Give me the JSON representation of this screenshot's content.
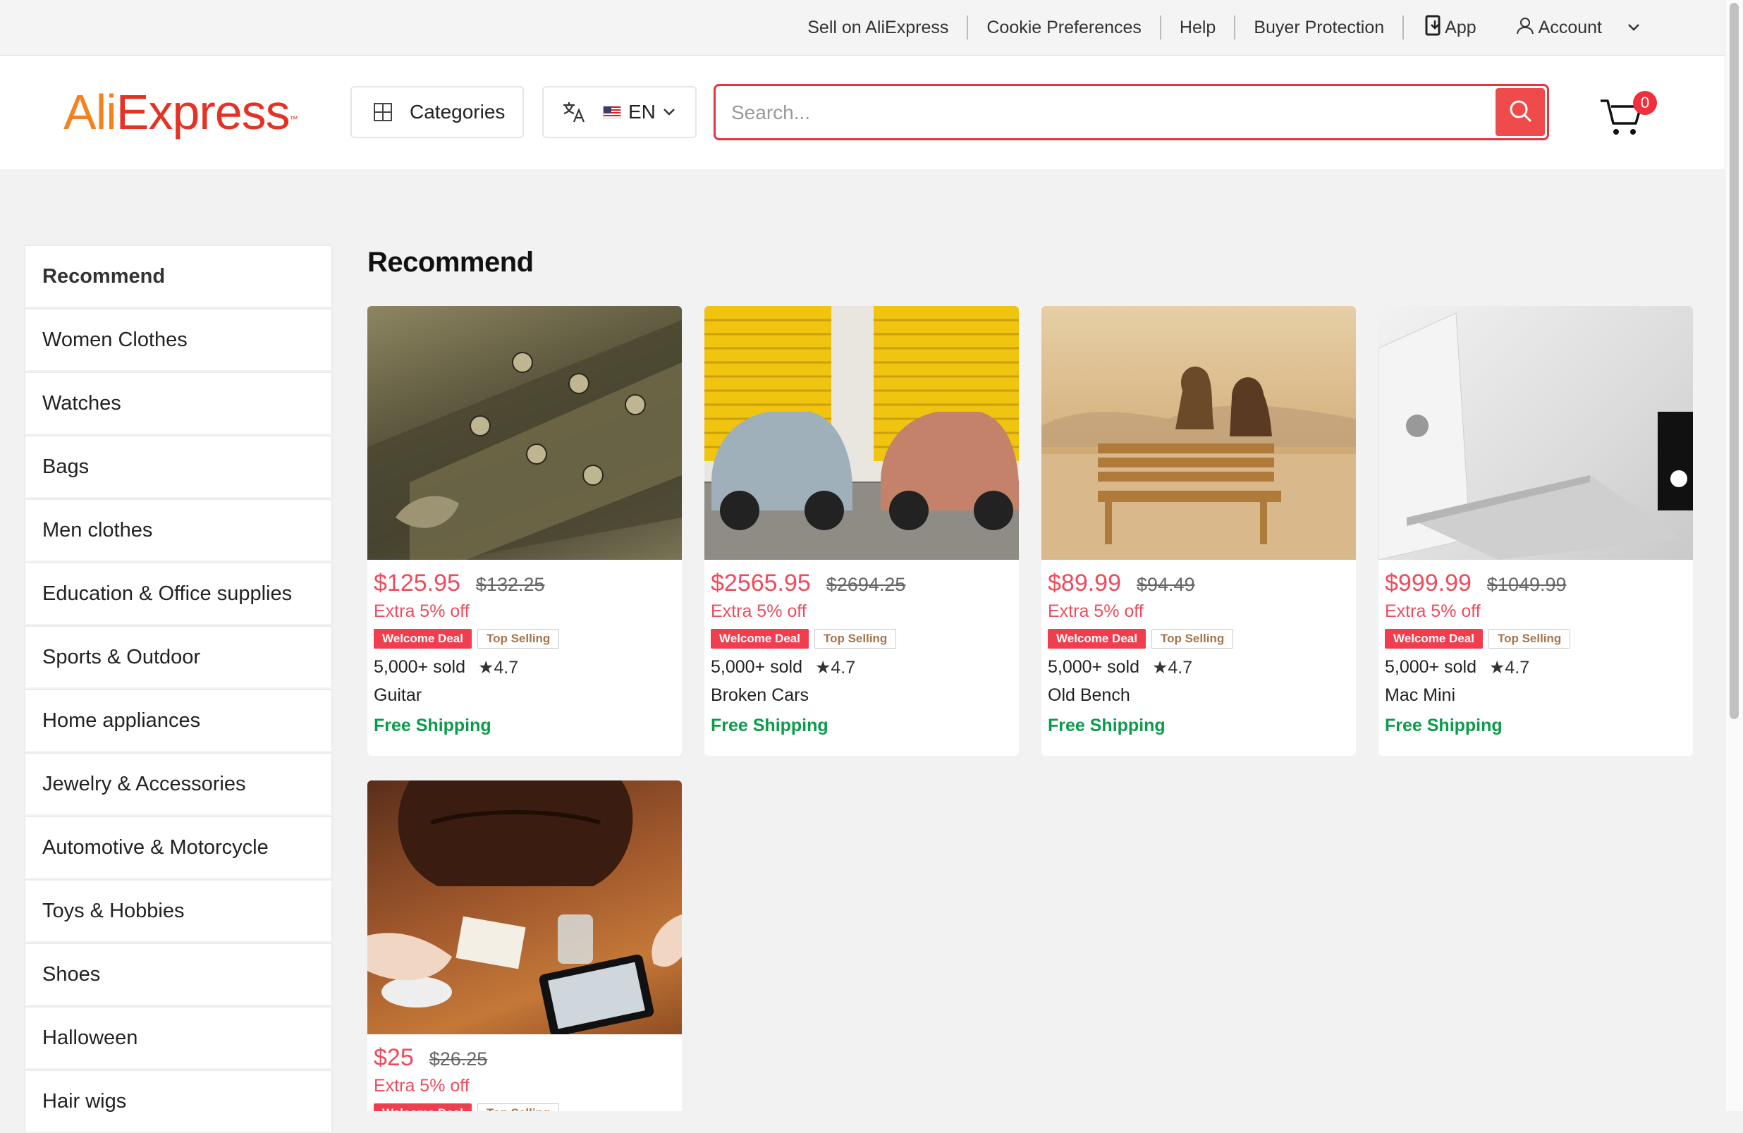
{
  "topbar": {
    "links": [
      "Sell on AliExpress",
      "Cookie Preferences",
      "Help",
      "Buyer Protection"
    ],
    "app_label": "App",
    "account_label": "Account"
  },
  "header": {
    "logo_part1": "Ali",
    "logo_part2": "Express",
    "categories_label": "Categories",
    "language_label": "EN",
    "search_placeholder": "Search...",
    "cart_count": "0"
  },
  "sidebar": {
    "items": [
      "Recommend",
      "Women Clothes",
      "Watches",
      "Bags",
      "Men clothes",
      "Education & Office supplies",
      "Sports & Outdoor",
      "Home appliances",
      "Jewelry & Accessories",
      "Automotive & Motorcycle",
      "Toys & Hobbies",
      "Shoes",
      "Halloween",
      "Hair wigs"
    ]
  },
  "main": {
    "title": "Recommend",
    "products": [
      {
        "price": "$125.95",
        "old_price": "$132.25",
        "extra": "Extra 5% off",
        "tag1": "Welcome Deal",
        "tag2": "Top Selling",
        "sold": "5,000+ sold",
        "rating": "★4.7",
        "name": "Guitar",
        "shipping": "Free Shipping",
        "image": "guitar-headstock-photo"
      },
      {
        "price": "$2565.95",
        "old_price": "$2694.25",
        "extra": "Extra 5% off",
        "tag1": "Welcome Deal",
        "tag2": "Top Selling",
        "sold": "5,000+ sold",
        "rating": "★4.7",
        "name": "Broken Cars",
        "shipping": "Free Shipping",
        "image": "vintage-cars-photo"
      },
      {
        "price": "$89.99",
        "old_price": "$94.49",
        "extra": "Extra 5% off",
        "tag1": "Welcome Deal",
        "tag2": "Top Selling",
        "sold": "5,000+ sold",
        "rating": "★4.7",
        "name": "Old Bench",
        "shipping": "Free Shipping",
        "image": "couple-on-bench-photo"
      },
      {
        "price": "$999.99",
        "old_price": "$1049.99",
        "extra": "Extra 5% off",
        "tag1": "Welcome Deal",
        "tag2": "Top Selling",
        "sold": "5,000+ sold",
        "rating": "★4.7",
        "name": "Mac Mini",
        "shipping": "Free Shipping",
        "image": "laptop-desk-photo"
      },
      {
        "price": "$25",
        "old_price": "$26.25",
        "extra": "Extra 5% off",
        "tag1": "Welcome Deal",
        "tag2": "Top Selling",
        "image": "leather-bag-table-photo"
      }
    ]
  },
  "colors": {
    "accent": "#f04b5c",
    "brand_orange": "#f5821f",
    "brand_red": "#e43225",
    "shipping_green": "#0a9c4a"
  }
}
